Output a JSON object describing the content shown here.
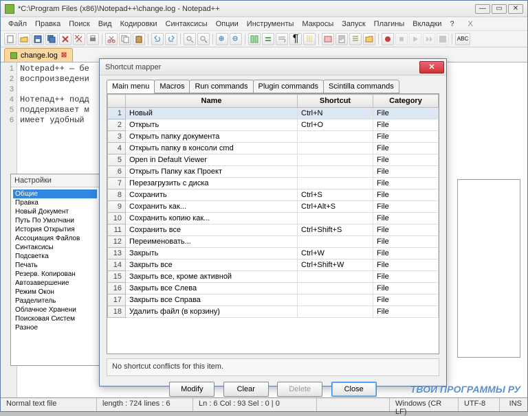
{
  "window": {
    "title": "*C:\\Program Files (x86)\\Notepad++\\change.log - Notepad++"
  },
  "menubar": [
    "Файл",
    "Правка",
    "Поиск",
    "Вид",
    "Кодировки",
    "Синтаксисы",
    "Опции",
    "Инструменты",
    "Макросы",
    "Запуск",
    "Плагины",
    "Вкладки",
    "?"
  ],
  "filetab": {
    "label": "change.log"
  },
  "editor": {
    "lines": [
      "1",
      "2",
      "3",
      "4",
      "5",
      "6"
    ],
    "code": "Notepad++ — бе\nвоспроизведени\n\nНотепад++ подд\nподдерживает м\nимеет удобный "
  },
  "settings": {
    "title": "Настройки",
    "items": [
      {
        "label": "Общие",
        "sel": true
      },
      {
        "label": "Правка"
      },
      {
        "label": "Новый Документ"
      },
      {
        "label": "Путь По Умолчани"
      },
      {
        "label": "История Открытия"
      },
      {
        "label": "Ассоциация Файлов"
      },
      {
        "label": "Синтаксисы"
      },
      {
        "label": "Подсветка"
      },
      {
        "label": "Печать"
      },
      {
        "label": "Резерв. Копирован"
      },
      {
        "label": "Автозавершение"
      },
      {
        "label": "Режим Окон"
      },
      {
        "label": "Разделитель"
      },
      {
        "label": "Облачное Хранени"
      },
      {
        "label": "Поисковая Систем"
      },
      {
        "label": "Разное"
      }
    ]
  },
  "dialog": {
    "title": "Shortcut mapper",
    "tabs": [
      "Main menu",
      "Macros",
      "Run commands",
      "Plugin commands",
      "Scintilla commands"
    ],
    "activeTab": 0,
    "headers": {
      "num": "",
      "name": "Name",
      "shortcut": "Shortcut",
      "category": "Category"
    },
    "rows": [
      {
        "n": "1",
        "name": "Новый",
        "shortcut": "Ctrl+N",
        "cat": "File",
        "sel": true
      },
      {
        "n": "2",
        "name": "Открыть",
        "shortcut": "Ctrl+O",
        "cat": "File"
      },
      {
        "n": "3",
        "name": "Открыть папку документа",
        "shortcut": "",
        "cat": "File"
      },
      {
        "n": "4",
        "name": "Открыть папку в консоли cmd",
        "shortcut": "",
        "cat": "File"
      },
      {
        "n": "5",
        "name": "Open in Default Viewer",
        "shortcut": "",
        "cat": "File"
      },
      {
        "n": "6",
        "name": "Открыть Папку как Проект",
        "shortcut": "",
        "cat": "File"
      },
      {
        "n": "7",
        "name": "Перезагрузить с диска",
        "shortcut": "",
        "cat": "File"
      },
      {
        "n": "8",
        "name": "Сохранить",
        "shortcut": "Ctrl+S",
        "cat": "File"
      },
      {
        "n": "9",
        "name": "Сохранить как...",
        "shortcut": "Ctrl+Alt+S",
        "cat": "File"
      },
      {
        "n": "10",
        "name": "Сохранить копию как...",
        "shortcut": "",
        "cat": "File"
      },
      {
        "n": "11",
        "name": "Сохранить все",
        "shortcut": "Ctrl+Shift+S",
        "cat": "File"
      },
      {
        "n": "12",
        "name": "Переименовать...",
        "shortcut": "",
        "cat": "File"
      },
      {
        "n": "13",
        "name": "Закрыть",
        "shortcut": "Ctrl+W",
        "cat": "File"
      },
      {
        "n": "14",
        "name": "Закрыть все",
        "shortcut": "Ctrl+Shift+W",
        "cat": "File"
      },
      {
        "n": "15",
        "name": "Закрыть все, кроме активной",
        "shortcut": "",
        "cat": "File"
      },
      {
        "n": "16",
        "name": "Закрыть все Слева",
        "shortcut": "",
        "cat": "File"
      },
      {
        "n": "17",
        "name": "Закрыть все Справа",
        "shortcut": "",
        "cat": "File"
      },
      {
        "n": "18",
        "name": "Удалить файл (в корзину)",
        "shortcut": "",
        "cat": "File"
      }
    ],
    "info": "No shortcut conflicts for this item.",
    "buttons": {
      "modify": "Modify",
      "clear": "Clear",
      "delete": "Delete",
      "close": "Close"
    }
  },
  "statusbar": {
    "type": "Normal text file",
    "len": "length : 724    lines : 6",
    "pos": "Ln : 6    Col : 93    Sel : 0 | 0",
    "eol": "Windows (CR LF)",
    "enc": "UTF-8",
    "mode": "INS"
  },
  "watermark": "ТВОИ ПРОГРАММЫ РУ"
}
